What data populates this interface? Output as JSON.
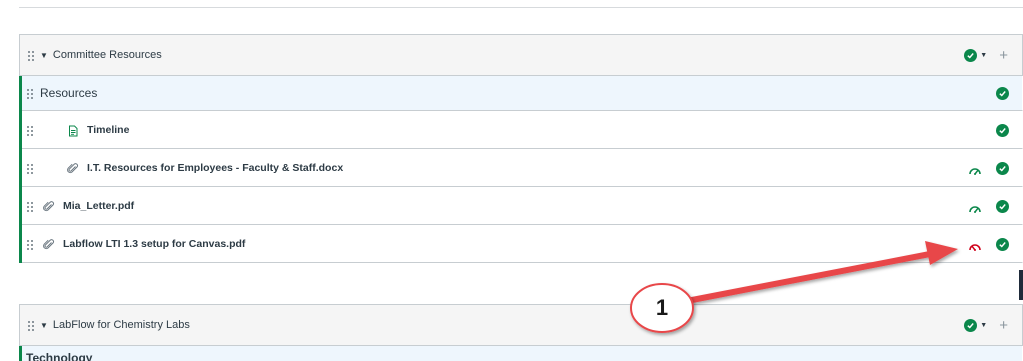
{
  "modules": [
    {
      "title": "Committee Resources",
      "items": [
        {
          "title": "Resources",
          "kind": "subheader",
          "icon": "",
          "indent": 0,
          "mastery": "",
          "published": true
        },
        {
          "title": "Timeline",
          "kind": "page",
          "icon": "page-icon",
          "indent": 1,
          "mastery": "",
          "published": true
        },
        {
          "title": "I.T. Resources for Employees - Faculty & Staff.docx",
          "kind": "file",
          "icon": "paperclip-icon",
          "indent": 1,
          "mastery": "complete",
          "published": true
        },
        {
          "title": "Mia_Letter.pdf",
          "kind": "file",
          "icon": "paperclip-icon",
          "indent": 0,
          "mastery": "complete",
          "published": true
        },
        {
          "title": "Labflow LTI 1.3 setup for Canvas.pdf",
          "kind": "file",
          "icon": "paperclip-icon",
          "indent": 0,
          "mastery": "incomplete",
          "published": true
        }
      ]
    },
    {
      "title": "LabFlow for Chemistry Labs",
      "items": [
        {
          "title": "Technology",
          "kind": "subheader",
          "icon": "",
          "indent": 0,
          "mastery": "",
          "published": true
        }
      ]
    }
  ],
  "callout": {
    "label": "1"
  },
  "colors": {
    "published_green": "#0b874b",
    "gauge_green": "#0b874b",
    "gauge_red": "#d0021b",
    "callout_red": "#e8474a"
  }
}
